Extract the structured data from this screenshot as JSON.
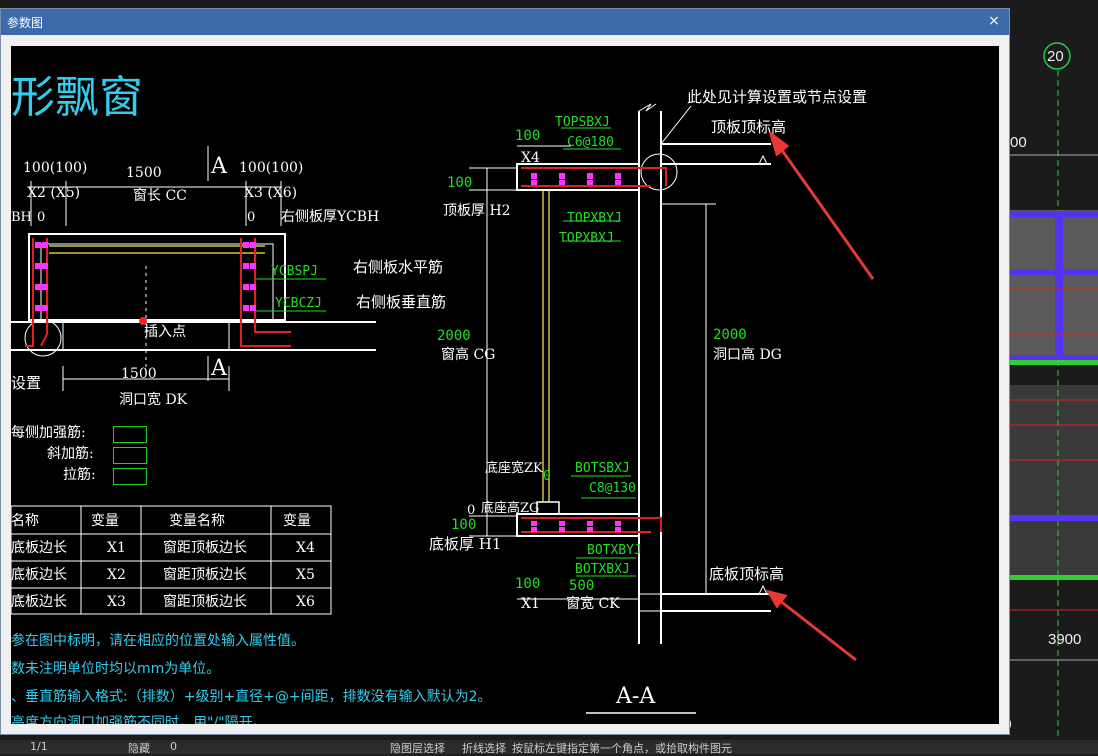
{
  "dialog": {
    "title": "参数图",
    "close_glyph": "×"
  },
  "background": {
    "grid_label": "20",
    "dim_left": "00",
    "dim_right": "3900",
    "corner_digit": "9"
  },
  "drawing": {
    "heading": "形飘窗",
    "plan": {
      "x2_val": "100(100)",
      "x2_label": "X2 (X5)",
      "cc_val": "1500",
      "cc_label": "窗长 CC",
      "x3_val": "100(100)",
      "x3_label": "X3 (X6)",
      "section_a": "A",
      "ycbh_left": "BH",
      "zero_left": "0",
      "zero_right": "0",
      "ycbh_label": "右侧板厚YCBH",
      "ycbspj": "YCBSPJ",
      "ycbspj_label": "右侧板水平筋",
      "ycbczj": "YCBCZJ",
      "ycbczj_label": "右侧板垂直筋",
      "insert_point": "插入点",
      "dk_val": "1500",
      "dk_label": "洞口宽 DK",
      "setting": "设置"
    },
    "rebar": {
      "each_side": "每侧加强筋:",
      "diagonal": "斜加筋:",
      "tie": "拉筋:"
    },
    "table": {
      "headers": [
        "名称",
        "变量",
        "变量名称",
        "变量"
      ],
      "rows": [
        [
          "底板边长",
          "X1",
          "窗距顶板边长",
          "X4"
        ],
        [
          "底板边长",
          "X2",
          "窗距顶板边长",
          "X5"
        ],
        [
          "底板边长",
          "X3",
          "窗距顶板边长",
          "X6"
        ]
      ]
    },
    "notes": [
      "参在图中标明，请在相应的位置处输入属性值。",
      "数未注明单位时均以mm为单位。",
      "、垂直筋输入格式:（排数）+级别+直径+@+间距，排数没有输入默认为2。",
      "高度方向洞口加强筋不同时，用\"/\"隔开。"
    ],
    "section": {
      "topsbxj": "TOPSBXJ",
      "x4_val": "100",
      "x4_label": "X4",
      "c6": "C6@180",
      "top_h_val": "100",
      "h2_label": "顶板厚 H2",
      "topxbyj": "TOPXBYJ",
      "topxbxj": "TOPXBXJ",
      "calc_note": "此处见计算设置或节点设置",
      "top_elev": "顶板顶标高",
      "cg_val": "2000",
      "cg_label": "窗高 CG",
      "dg_val": "2000",
      "dg_label": "洞口高 DG",
      "zk_label": "底座宽ZK",
      "zg_label": "底座高ZG",
      "zero": "0",
      "botsbxj": "BOTSBXJ",
      "c8": "C8@130",
      "bot_h_val": "100",
      "h1_label": "底板厚 H1",
      "botxbyj": "BOTXBYJ",
      "botxbxj": "BOTXBXJ",
      "bot_elev": "底板顶标高",
      "x1_val": "100",
      "x1_label": "X1",
      "ck_val": "500",
      "ck_label": "窗宽 CK",
      "title": "A-A"
    }
  },
  "taskbar": {
    "items": [
      "1/1",
      "隐藏",
      "0",
      "隐图层选择",
      "折线选择",
      "按鼠标左键指定第一个角点，或拾取构件图元"
    ]
  },
  "colors": {
    "titlebar": "#3d6aa8",
    "rebar_red": "#e02020",
    "stirrup_magenta": "#ff33ff",
    "dim_green": "#22dd22",
    "note_cyan": "#33ccee",
    "arrow_red": "#e53935"
  }
}
